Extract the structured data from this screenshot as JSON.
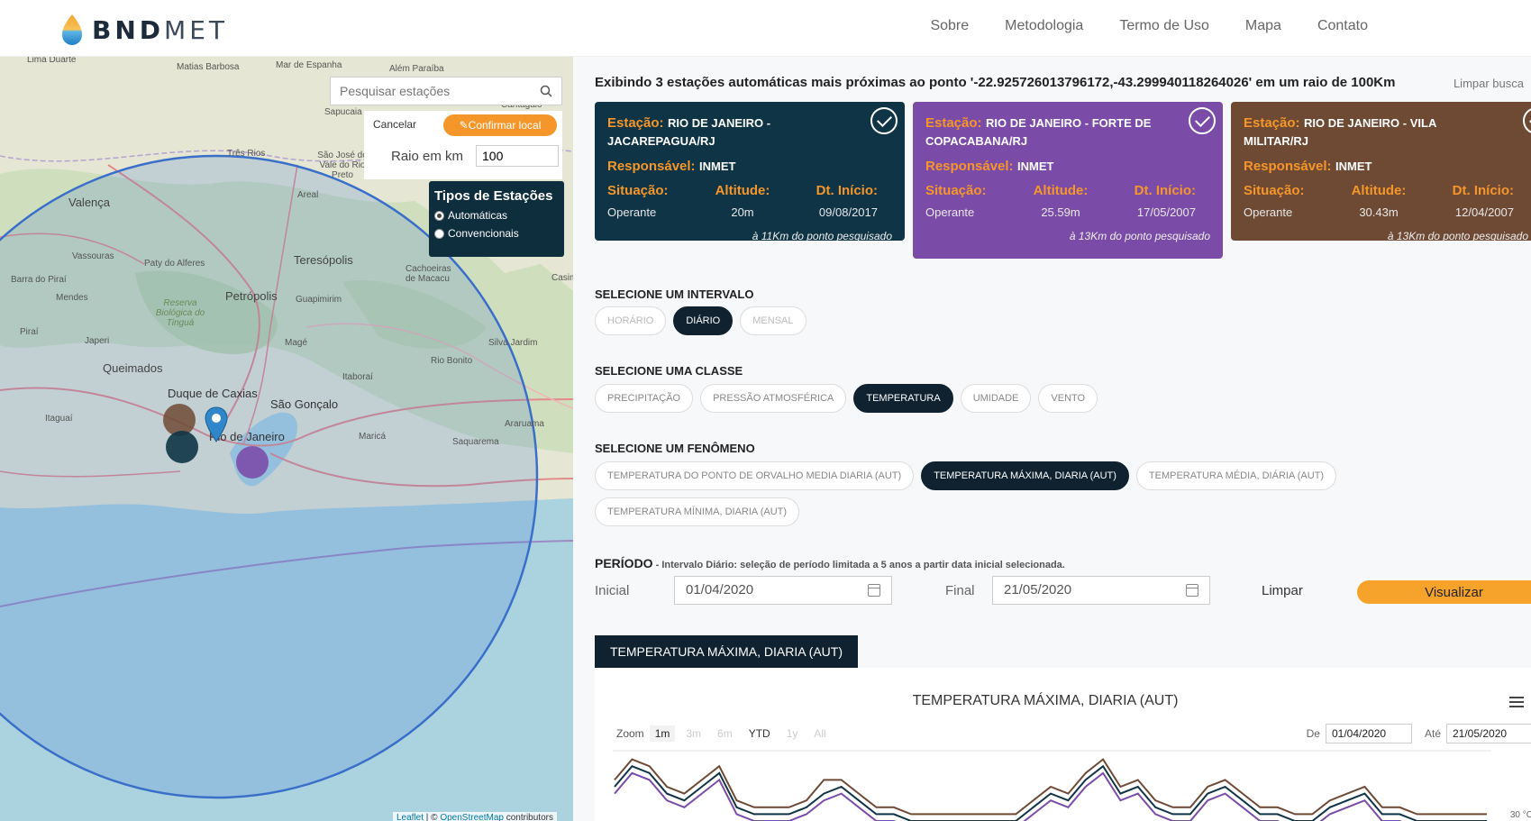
{
  "header": {
    "logo_bold": "BND",
    "logo_light": "MET",
    "nav": [
      "Sobre",
      "Metodologia",
      "Termo de Uso",
      "Mapa",
      "Contato"
    ]
  },
  "map": {
    "search_placeholder": "Pesquisar estações",
    "cancel_label": "Cancelar",
    "confirm_label": "Confirmar local",
    "radius_label": "Raio em km",
    "radius_value": "100",
    "station_types": {
      "title": "Tipos de Estações",
      "options": [
        "Automáticas",
        "Convencionais"
      ],
      "selected": "Automáticas"
    },
    "labels": {
      "lima_duarte": "Lima Duarte",
      "matias_barbosa": "Matias Barbosa",
      "mar_de_espanha": "Mar de Espanha",
      "alem_paraiba": "Além Paraíba",
      "cantagalo": "Cantagalo",
      "sapucaia": "Sapucaia",
      "tres_rios": "Três Rios",
      "sao_jose": "São José do Vale do Rio Preto",
      "valenca": "Valença",
      "areal": "Areal",
      "vassouras": "Vassouras",
      "paty": "Paty do Alferes",
      "teresopolis": "Teresópolis",
      "cachoeiras": "Cachoeiras de Macacu",
      "barra_pirai": "Barra do Piraí",
      "mendes": "Mendes",
      "petropolis": "Petrópolis",
      "guapimirim": "Guapimirim",
      "reserva": "Reserva Biológica do Tinguá",
      "pirai": "Piraí",
      "japeri": "Japeri",
      "mage": "Magé",
      "silva_jardim": "Silva Jardim",
      "queimados": "Queimados",
      "rio_bonito": "Rio Bonito",
      "itaborai": "Itaboraí",
      "duque": "Duque de Caxias",
      "sao_goncalo": "São Gonçalo",
      "itaguai": "Itaguaí",
      "rio": "Rio de Janeiro",
      "marica": "Maricá",
      "araruama": "Araruama",
      "saquarema": "Saquarema",
      "casim": "Casim"
    },
    "attribution_leaflet": "Leaflet",
    "attribution_sep": " | © ",
    "attribution_osm": "OpenStreetMap",
    "attribution_rest": " contributors"
  },
  "results": {
    "title": "Exibindo 3 estações automáticas mais próximas ao ponto '-22.925726013796172,-43.299940118264026' em um raio de 100Km",
    "clear_search": "Limpar busca",
    "labels": {
      "estacao": "Estação:",
      "responsavel": "Responsável:",
      "situacao": "Situação:",
      "altitude": "Altitude:",
      "dt_inicio": "Dt. Início:"
    },
    "stations": [
      {
        "name": "RIO DE JANEIRO - JACAREPAGUA/RJ",
        "responsible": "INMET",
        "status": "Operante",
        "altitude": "20m",
        "start": "09/08/2017",
        "distance": "à 11Km do ponto pesquisado",
        "color": "#0f3446"
      },
      {
        "name": "RIO DE JANEIRO - FORTE DE COPACABANA/RJ",
        "responsible": "INMET",
        "status": "Operante",
        "altitude": "25.59m",
        "start": "17/05/2007",
        "distance": "à 13Km do ponto pesquisado",
        "color": "#7b4ba8"
      },
      {
        "name": "RIO DE JANEIRO - VILA MILITAR/RJ",
        "responsible": "INMET",
        "status": "Operante",
        "altitude": "30.43m",
        "start": "12/04/2007",
        "distance": "à 13Km do ponto pesquisado",
        "color": "#6e4a34"
      }
    ]
  },
  "interval": {
    "title": "SELECIONE UM INTERVALO",
    "options": [
      "HORÁRIO",
      "DIÁRIO",
      "MENSAL"
    ],
    "selected": "DIÁRIO"
  },
  "classe": {
    "title": "SELECIONE UMA CLASSE",
    "options": [
      "PRECIPITAÇÃO",
      "PRESSÃO ATMOSFÉRICA",
      "TEMPERATURA",
      "UMIDADE",
      "VENTO"
    ],
    "selected": "TEMPERATURA"
  },
  "fenomeno": {
    "title": "SELECIONE UM FENÔMENO",
    "options": [
      "TEMPERATURA DO PONTO DE ORVALHO MEDIA DIARIA (AUT)",
      "TEMPERATURA MÁXIMA, DIARIA (AUT)",
      "TEMPERATURA MÉDIA, DIÁRIA (AUT)",
      "TEMPERATURA MÍNIMA, DIARIA (AUT)"
    ],
    "selected": "TEMPERATURA MÁXIMA, DIARIA (AUT)"
  },
  "periodo": {
    "title": "PERÍODO",
    "note": " - Intervalo Diário: seleção de período limitada a 5 anos a partir data inicial selecionada.",
    "initial_label": "Inicial",
    "initial_value": "01/04/2020",
    "final_label": "Final",
    "final_value": "21/05/2020",
    "clear_label": "Limpar",
    "view_label": "Visualizar"
  },
  "chart": {
    "tab_label": "TEMPERATURA MÁXIMA, DIARIA (AUT)",
    "title": "TEMPERATURA MÁXIMA, DIARIA (AUT)",
    "zoom_label": "Zoom",
    "zoom_options": [
      "1m",
      "3m",
      "6m",
      "YTD",
      "1y",
      "All"
    ],
    "zoom_selected": "1m",
    "from_label": "De",
    "from_value": "01/04/2020",
    "to_label": "Até",
    "to_value": "21/05/2020",
    "y_tick": "30 °C"
  },
  "chart_data": {
    "type": "line",
    "title": "TEMPERATURA MÁXIMA, DIARIA (AUT)",
    "ylabel": "",
    "y_ticks": [
      "30 °C"
    ],
    "x_range": [
      "01/04/2020",
      "21/05/2020"
    ],
    "series": [
      {
        "color": "#0f3446",
        "values": [
          31,
          34,
          33,
          30,
          29,
          31,
          33,
          28,
          27,
          27,
          27,
          28,
          30,
          31,
          29,
          27,
          27,
          26,
          26,
          26,
          26,
          26,
          26,
          26,
          28,
          30,
          29,
          32,
          34,
          30,
          31,
          28,
          27,
          27,
          30,
          31,
          29,
          27,
          27,
          26,
          26,
          28,
          29,
          30,
          27,
          27,
          26,
          26,
          26,
          26,
          26
        ]
      },
      {
        "color": "#7b4ba8",
        "values": [
          30,
          33,
          32,
          29,
          28,
          30,
          32,
          27,
          26,
          26,
          26,
          27,
          29,
          30,
          28,
          26,
          26,
          25,
          25,
          25,
          25,
          25,
          25,
          25,
          27,
          29,
          28,
          31,
          33,
          29,
          30,
          27,
          26,
          26,
          29,
          30,
          28,
          26,
          26,
          25,
          25,
          27,
          28,
          29,
          26,
          26,
          25,
          25,
          25,
          25,
          25
        ]
      },
      {
        "color": "#6e4a34",
        "values": [
          32,
          35,
          34,
          31,
          30,
          32,
          34,
          29,
          28,
          28,
          28,
          29,
          32,
          32,
          30,
          28,
          28,
          27,
          27,
          27,
          27,
          27,
          27,
          27,
          29,
          31,
          30,
          33,
          35,
          31,
          32,
          29,
          28,
          28,
          31,
          32,
          30,
          28,
          28,
          27,
          27,
          29,
          30,
          31,
          28,
          28,
          27,
          27,
          27,
          27,
          27
        ]
      }
    ]
  }
}
